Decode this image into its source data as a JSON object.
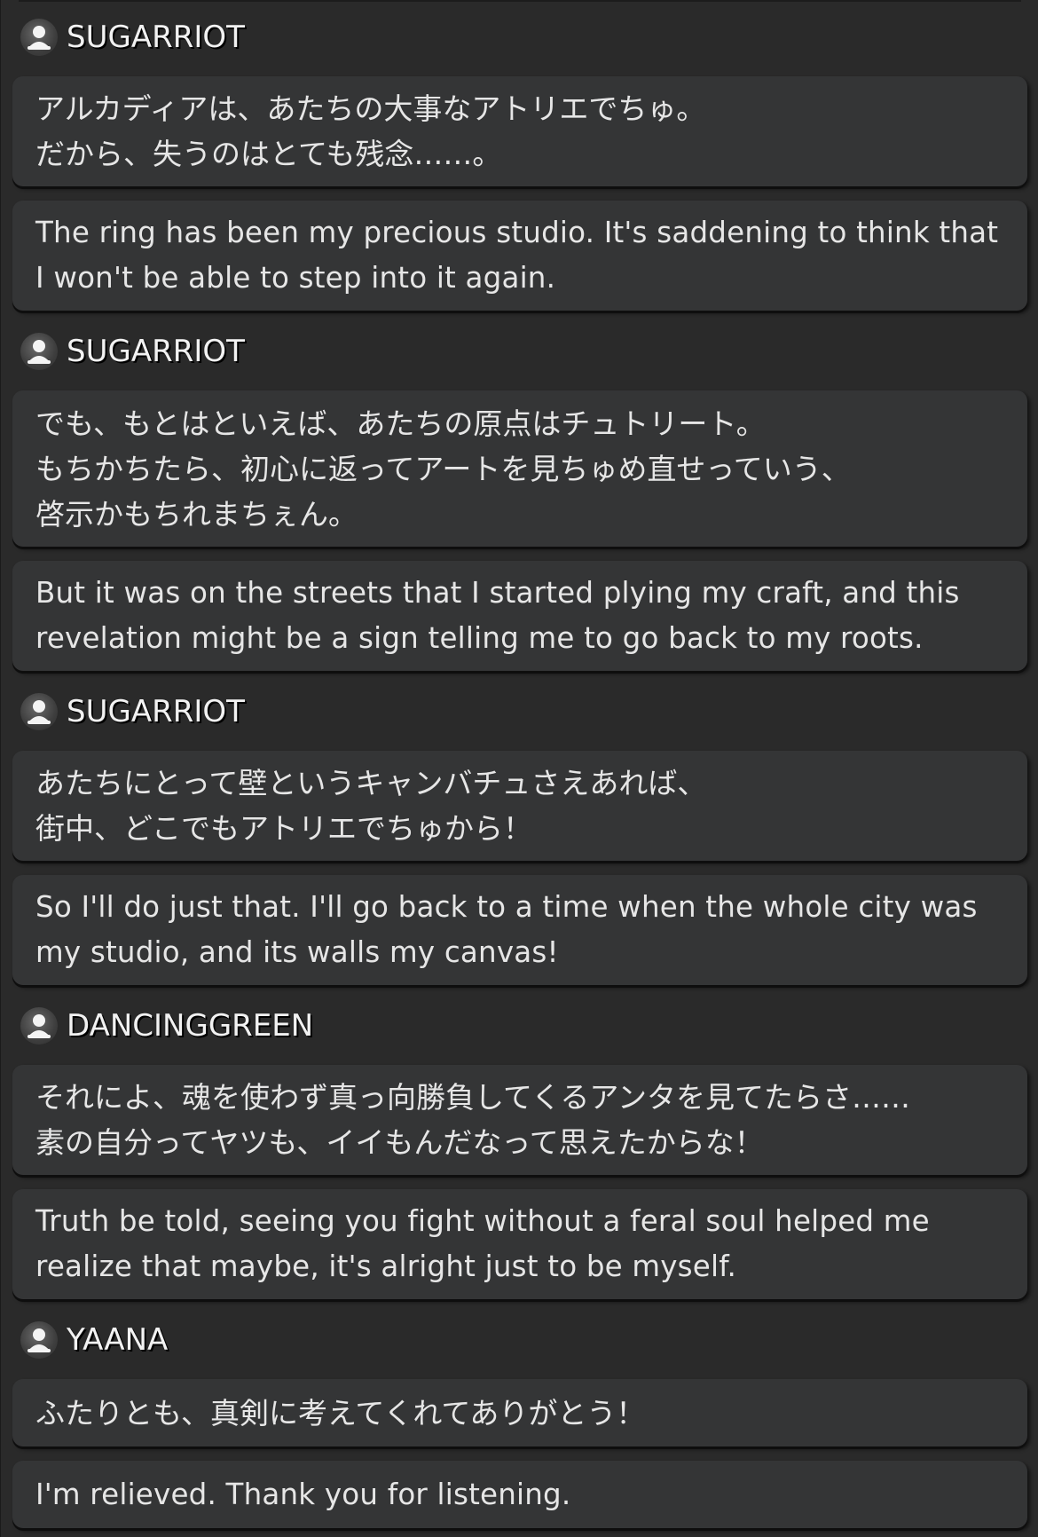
{
  "dialogue": [
    {
      "speaker": "SUGARRIOT",
      "jp": "アルカディアは、あたちの大事なアトリエでちゅ。\nだから、失うのはとても残念……。",
      "en": "The ring has been my precious studio. It's saddening to think that\nI won't be able to step into it again."
    },
    {
      "speaker": "SUGARRIOT",
      "jp": "でも、もとはといえば、あたちの原点はチュトリート。\nもちかちたら、初心に返ってアートを見ちゅめ直せっていう、\n啓示かもちれまちぇん。",
      "en": "But it was on the streets that I started plying my craft, and this\nrevelation might be a sign telling me to go back to my roots."
    },
    {
      "speaker": "SUGARRIOT",
      "jp": "あたちにとって壁というキャンバチュさえあれば、\n街中、どこでもアトリエでちゅから！",
      "en": "So I'll do just that. I'll go back to a time when the whole city was\nmy studio, and its walls my canvas!"
    },
    {
      "speaker": "DANCINGGREEN",
      "jp": "それによ、魂を使わず真っ向勝負してくるアンタを見てたらさ……\n素の自分ってヤツも、イイもんだなって思えたからな！",
      "en": "Truth be told, seeing you fight without a feral soul helped me\nrealize that maybe, it's alright just to be myself."
    },
    {
      "speaker": "YAANA",
      "jp": "ふたりとも、真剣に考えてくれてありがとう！",
      "en": "I'm relieved. Thank you for listening."
    }
  ],
  "icons": {
    "avatar": "person-silhouette-icon"
  },
  "colors": {
    "background": "#2a2a2a",
    "bubble": "#343536",
    "text": "#e6e6e6",
    "speaker_name": "#f2f2f2"
  }
}
